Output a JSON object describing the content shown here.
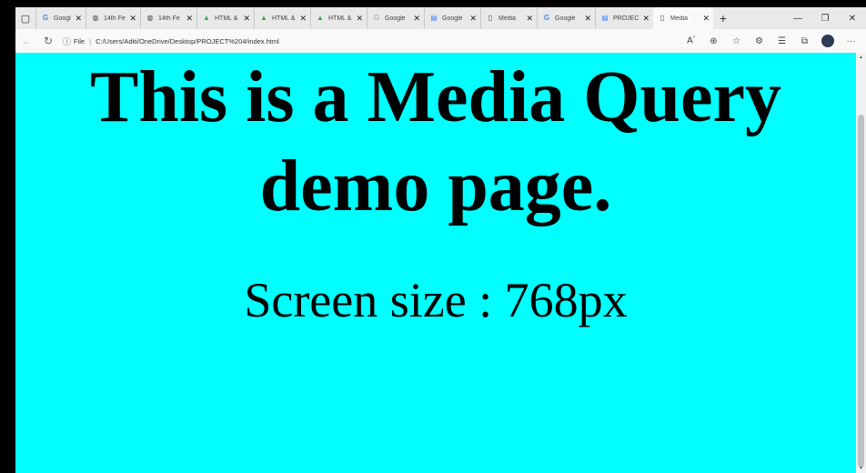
{
  "browser": {
    "tabs": [
      {
        "icon": "google-icon",
        "title": "Google"
      },
      {
        "icon": "globe-icon",
        "title": "14th Fe"
      },
      {
        "icon": "globe-icon",
        "title": "14th Fe"
      },
      {
        "icon": "drive-icon",
        "title": "HTML &"
      },
      {
        "icon": "drive-icon",
        "title": "HTML &"
      },
      {
        "icon": "drive-icon",
        "title": "HTML &"
      },
      {
        "icon": "google-icon",
        "title": "Google"
      },
      {
        "icon": "docs-icon",
        "title": "Google"
      },
      {
        "icon": "file-icon",
        "title": "Media"
      },
      {
        "icon": "google-icon",
        "title": "Google"
      },
      {
        "icon": "docs-icon",
        "title": "PROJEC"
      },
      {
        "icon": "file-icon",
        "title": "Media"
      }
    ],
    "active_tab_index": 11,
    "address": {
      "label": "File",
      "url": "C:/Users/Aditi/OneDrive/Desktop/PROJECT%204/index.html"
    },
    "colors": {
      "page_background": "#00ffff",
      "tab_bar": "#e9e9e9"
    }
  },
  "page": {
    "heading": "This is a Media Query demo page.",
    "screen_size_text": "Screen size : 768px"
  }
}
